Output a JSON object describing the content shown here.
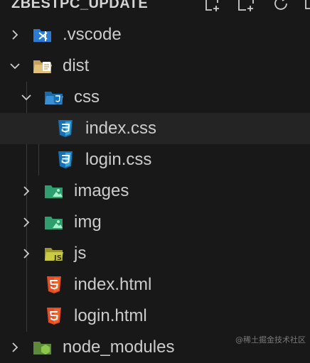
{
  "explorer": {
    "project_title": "ZBESTPC_UPDATE",
    "actions": [
      {
        "icon": "new-file-icon"
      },
      {
        "icon": "new-folder-icon"
      },
      {
        "icon": "refresh-icon"
      }
    ]
  },
  "tree": [
    {
      "label": ".vscode",
      "type": "folder",
      "expanded": false,
      "icon": "vscode-folder-icon"
    },
    {
      "label": "dist",
      "type": "folder",
      "expanded": true,
      "icon": "dist-folder-icon"
    },
    {
      "label": "css",
      "type": "folder",
      "expanded": true,
      "icon": "css-folder-icon"
    },
    {
      "label": "index.css",
      "type": "file",
      "icon": "css3-file-icon",
      "selected": true
    },
    {
      "label": "login.css",
      "type": "file",
      "icon": "css3-file-icon"
    },
    {
      "label": "images",
      "type": "folder",
      "expanded": false,
      "icon": "images-folder-icon"
    },
    {
      "label": "img",
      "type": "folder",
      "expanded": false,
      "icon": "images-folder-icon"
    },
    {
      "label": "js",
      "type": "folder",
      "expanded": false,
      "icon": "js-folder-icon"
    },
    {
      "label": "index.html",
      "type": "file",
      "icon": "html5-file-icon"
    },
    {
      "label": "login.html",
      "type": "file",
      "icon": "html5-file-icon"
    },
    {
      "label": "node_modules",
      "type": "folder",
      "expanded": false,
      "icon": "node-folder-icon"
    }
  ],
  "watermark": "@稀土掘金技术社区",
  "colors": {
    "background": "#181818",
    "selection": "#242424",
    "text": "#cccccc",
    "css_blue": "#1572b6",
    "html_orange": "#e44d26",
    "images_green": "#2e9e6e",
    "js_yellow": "#cbcb41",
    "vscode_blue": "#2a7bd3"
  }
}
